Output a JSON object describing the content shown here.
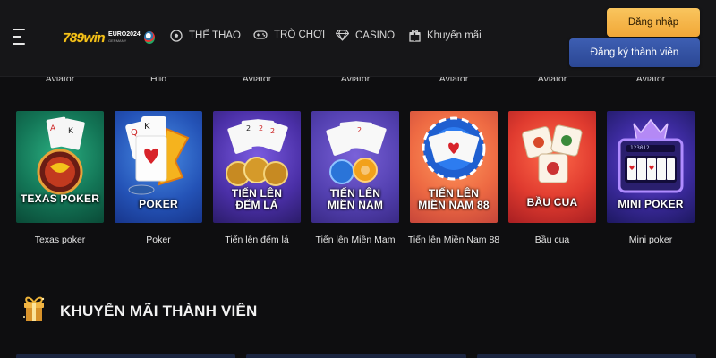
{
  "header": {
    "logo_text": "789win",
    "logo_sub_1": "EURO2024",
    "logo_sub_2": "GERMANY",
    "nav": [
      {
        "label": "THỂ THAO",
        "icon": "soccer-ball-icon"
      },
      {
        "label": "TRÒ CHƠI",
        "icon": "gamepad-icon"
      },
      {
        "label": "CASINO",
        "icon": "diamond-icon"
      },
      {
        "label": "Khuyến mãi",
        "icon": "gift-icon"
      }
    ],
    "login_label": "Đăng nhập",
    "register_label": "Đăng ký thành viên",
    "colors": {
      "login": "#f4b54a",
      "register": "#3553a6",
      "logo": "#f4c21a"
    }
  },
  "previous_row_captions": [
    "Aviator",
    "Hilo",
    "Aviator",
    "Aviator",
    "Aviator",
    "Aviator",
    "Aviator"
  ],
  "games": [
    {
      "art_title": "TEXAS POKER",
      "caption": "Texas poker"
    },
    {
      "art_title": "POKER",
      "caption": "Poker"
    },
    {
      "art_title": "TIẾN LÊN\nĐẾM LÁ",
      "art_title_1": "TIẾN LÊN",
      "art_title_2": "ĐẾM LÁ",
      "caption": "Tiến lên đếm lá"
    },
    {
      "art_title_1": "TIẾN LÊN",
      "art_title_2": "MIỀN NAM",
      "caption": "Tiến lên Miền Mam"
    },
    {
      "art_title_1": "TIẾN LÊN",
      "art_title_2": "MIỀN NAM 88",
      "caption": "Tiến lên Miền Nam 88"
    },
    {
      "art_title": "BẦU CUA",
      "caption": "Bầu cua"
    },
    {
      "art_title": "MINI POKER",
      "caption": "Mini poker",
      "screen_text": "123012"
    }
  ],
  "promo_section": {
    "title": "KHUYẾN MÃI THÀNH VIÊN",
    "icon": "gift-icon"
  }
}
